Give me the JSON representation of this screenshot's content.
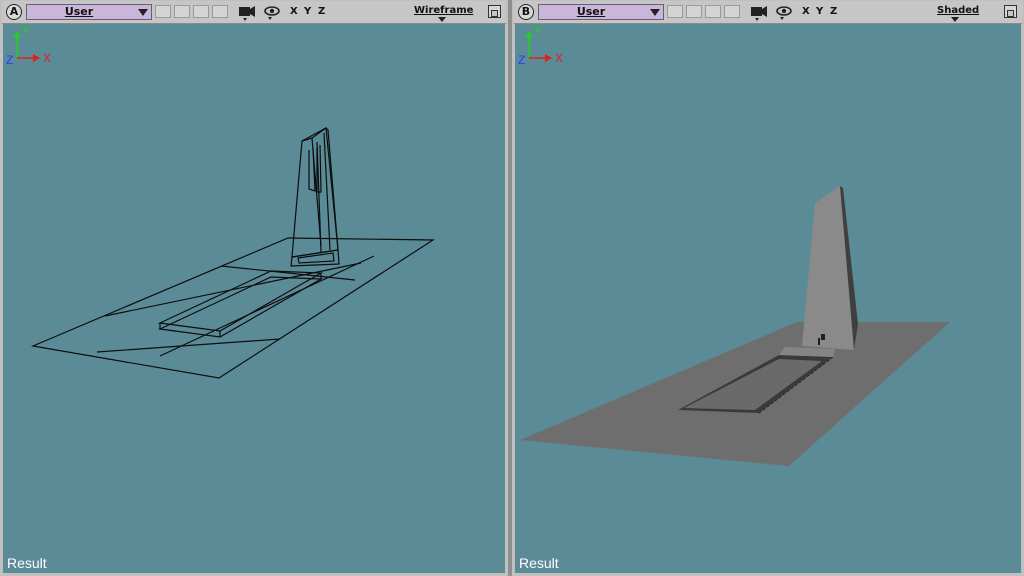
{
  "viewports": [
    {
      "letter": "A",
      "camera": "User",
      "axes": [
        "X",
        "Y",
        "Z"
      ],
      "mode": "Wireframe",
      "status": "Result",
      "gizmo": {
        "x": "X",
        "y": "Y",
        "z": "Z"
      },
      "icons": [
        "camera-icon",
        "eye-icon",
        "maximize-icon"
      ]
    },
    {
      "letter": "B",
      "camera": "User",
      "axes": [
        "X",
        "Y",
        "Z"
      ],
      "mode": "Shaded",
      "status": "Result",
      "gizmo": {
        "x": "X",
        "y": "Y",
        "z": "Z"
      },
      "icons": [
        "camera-icon",
        "eye-icon",
        "maximize-icon"
      ]
    }
  ],
  "colors": {
    "viewport_bg": "#5b8b97",
    "camera_dropdown": "#c9b6d9",
    "wire": "#0d0d0d",
    "ground_shaded": "#6e6e6e",
    "tower_shaded": "#8a8a8a",
    "axis_x": "#e02020",
    "axis_y": "#20d020",
    "axis_z": "#2040ff"
  }
}
